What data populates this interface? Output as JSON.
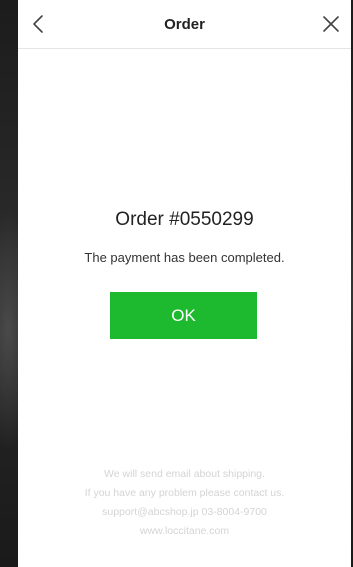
{
  "header": {
    "title": "Order",
    "back_icon": "chevron-left-icon",
    "close_icon": "close-icon"
  },
  "main": {
    "order_number": "Order #0550299",
    "status": "The payment has been completed.",
    "ok_label": "OK"
  },
  "footer": {
    "lines": [
      "We will send email about shipping.",
      "If you have any problem please contact us.",
      "support@abcshop.jp 03-8004-9700",
      "www.loccitane.com"
    ]
  },
  "colors": {
    "accent_green": "#1dba2f",
    "footer_text": "#d4d4d4",
    "title_text": "#222222"
  }
}
